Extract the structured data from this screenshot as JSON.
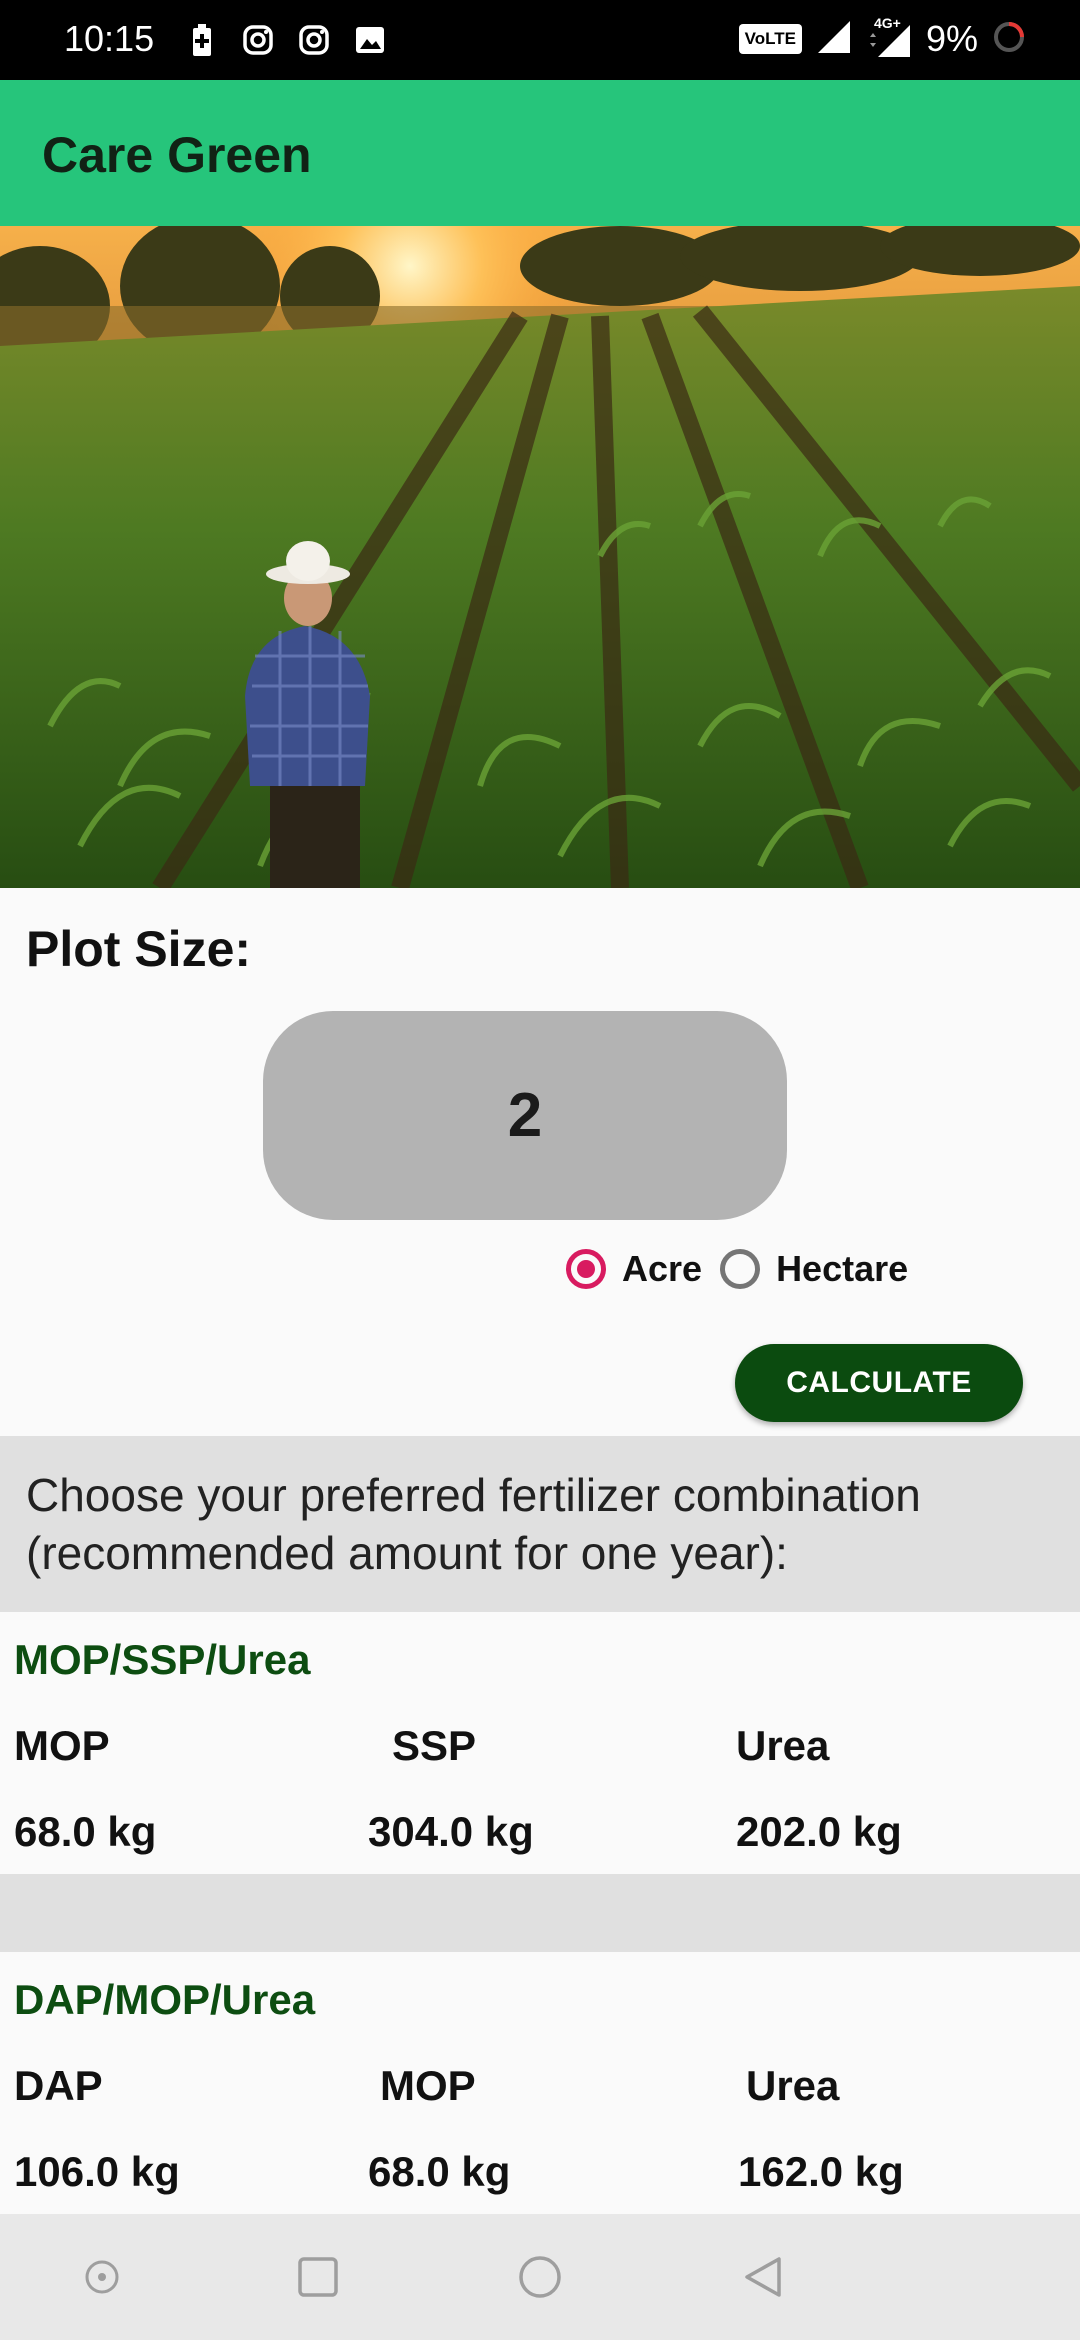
{
  "status_bar": {
    "time": "10:15",
    "network_badge": "VoLTE",
    "network_type": "4G+",
    "battery": "9%",
    "icons": [
      "battery-charging-icon",
      "instagram-icon",
      "instagram-icon",
      "image-icon",
      "signal-icon",
      "loading-icon"
    ]
  },
  "app": {
    "title": "Care Green",
    "accent_color": "#26c57b",
    "button_color": "#0b4b0f"
  },
  "form": {
    "plot_label": "Plot Size:",
    "plot_value": "2",
    "units": [
      {
        "label": "Acre",
        "selected": true
      },
      {
        "label": "Hectare",
        "selected": false
      }
    ],
    "calculate_label": "CALCULATE"
  },
  "instruction": "Choose your preferred fertilizer combination (recommended amount for one year):",
  "combos": [
    {
      "title": "MOP/SSP/Urea",
      "headers": [
        "MOP",
        "SSP",
        "Urea"
      ],
      "values": [
        "68.0 kg",
        "304.0 kg",
        "202.0 kg"
      ]
    },
    {
      "title": "DAP/MOP/Urea",
      "headers": [
        "DAP",
        "MOP",
        "Urea"
      ],
      "values": [
        "106.0 kg",
        "68.0 kg",
        "162.0 kg"
      ]
    }
  ],
  "nav": {
    "icons": [
      "dot-circle-icon",
      "recents-square-icon",
      "home-circle-icon",
      "back-triangle-icon"
    ]
  }
}
